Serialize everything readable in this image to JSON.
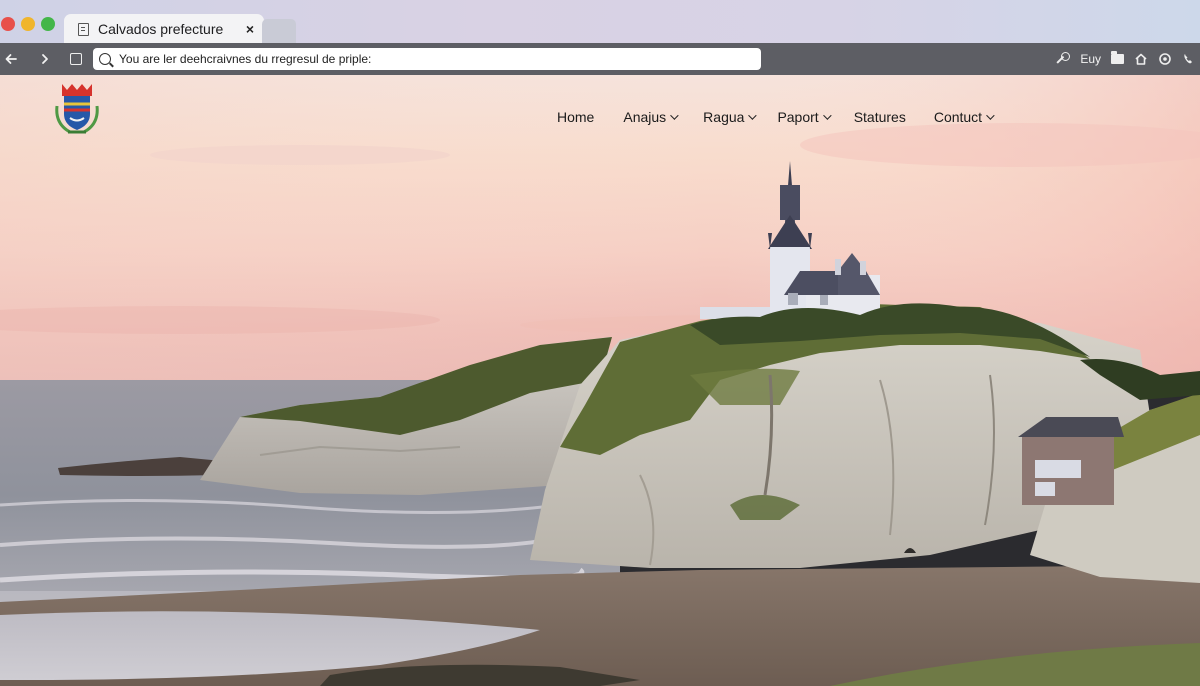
{
  "browser": {
    "tab_title": "Calvados prefecture",
    "tab_close": "×",
    "address_bar_text": "You are ler deehcraivnes du rregresul de priple:",
    "toolbar_right_label": "Euy"
  },
  "site": {
    "nav": {
      "home": "Home",
      "anajus": "Anajus",
      "ragua": "Ragua",
      "paport": "Paport",
      "statures": "Statures",
      "contuct": "Contuct"
    }
  },
  "colors": {
    "sky_top": "#f4d9d7",
    "sky_bottom": "#f0c2b8",
    "sea": "#9fa2b0",
    "cliff": "#cfcac0",
    "grass": "#59683a",
    "sand": "#8f7b6a"
  },
  "icons": {
    "back": "arrow-left",
    "forward": "arrow-right",
    "key": "key",
    "folder": "folder",
    "home": "house",
    "circle": "refresh-circle",
    "phone": "phone"
  }
}
